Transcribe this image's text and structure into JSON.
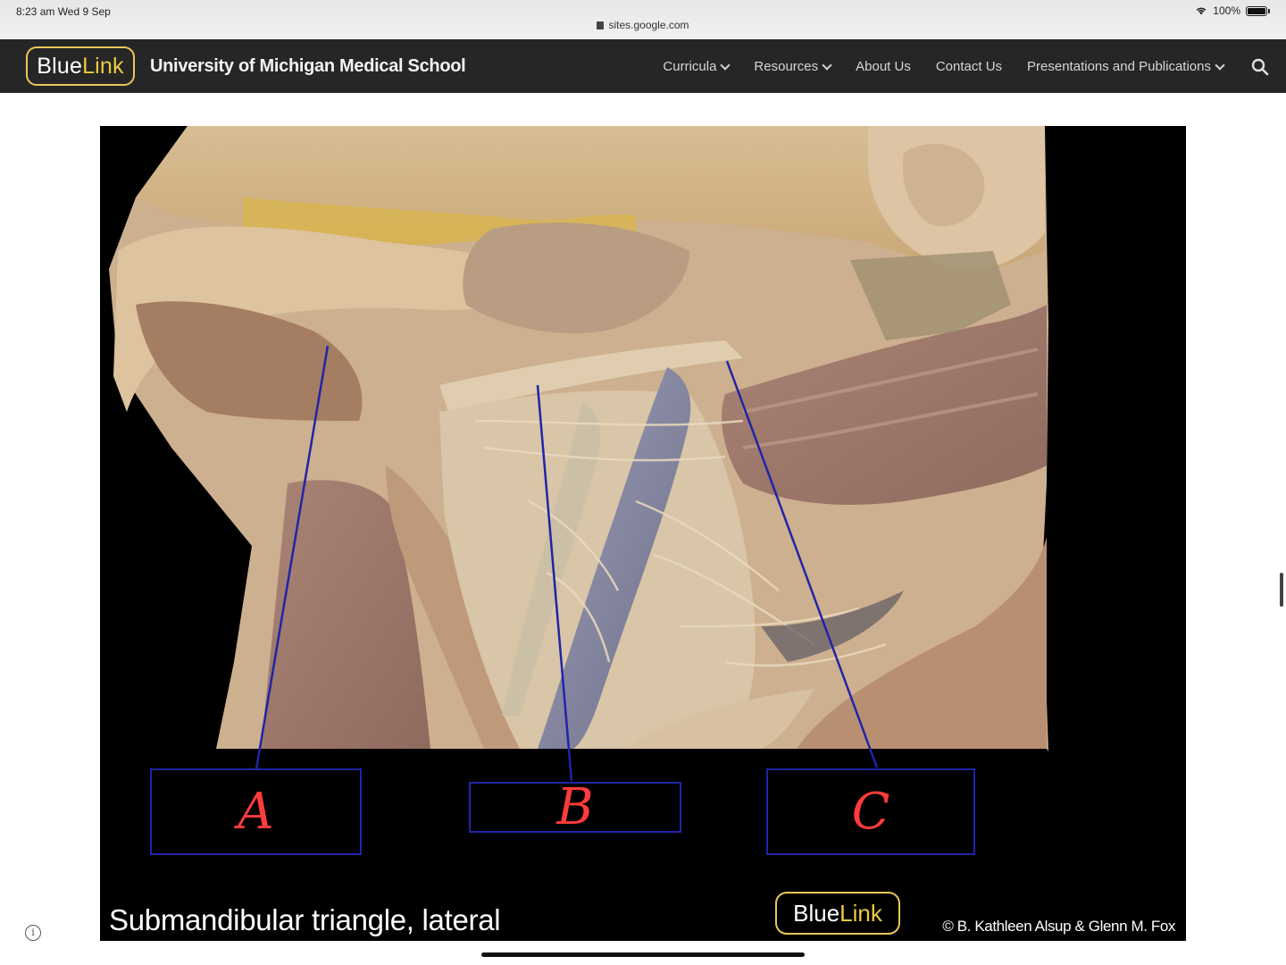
{
  "status_bar": {
    "time": "8:23 am   Wed 9 Sep",
    "url": "sites.google.com",
    "battery": "100%",
    "icons": [
      "wifi-icon",
      "battery-icon",
      "lock-icon"
    ]
  },
  "header": {
    "logo": {
      "part1": "Blue",
      "part2": "Link"
    },
    "title": "University of Michigan Medical School",
    "nav": [
      {
        "label": "Curricula",
        "dropdown": true
      },
      {
        "label": "Resources",
        "dropdown": true
      },
      {
        "label": "About Us",
        "dropdown": false
      },
      {
        "label": "Contact Us",
        "dropdown": false
      },
      {
        "label": "Presentations and Publications",
        "dropdown": true
      }
    ],
    "search_icon": "search-icon",
    "colors": {
      "bar": "#262626",
      "logo_accent": "#f0c93f"
    }
  },
  "figure": {
    "labels": [
      "A",
      "B",
      "C"
    ],
    "caption": "Submandibular triangle, lateral",
    "logo": {
      "part1": "Blue",
      "part2": "Link"
    },
    "credit": "© B. Kathleen Alsup & Glenn M. Fox",
    "colors": {
      "label_box": "#2124a8",
      "label_text": "#ff3b3b",
      "pointer_line": "#2124a8"
    }
  }
}
